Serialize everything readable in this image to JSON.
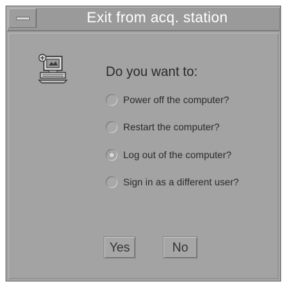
{
  "window": {
    "title": "Exit from acq. station"
  },
  "dialog": {
    "prompt": "Do you want to:",
    "options": [
      {
        "label": "Power off the computer?",
        "selected": false
      },
      {
        "label": "Restart the computer?",
        "selected": false
      },
      {
        "label": "Log out of the computer?",
        "selected": true
      },
      {
        "label": "Sign in as a different user?",
        "selected": false
      }
    ],
    "buttons": {
      "yes": "Yes",
      "no": "No"
    },
    "icon": "computer-icon"
  },
  "colors": {
    "background": "#a3a3a3",
    "title_text": "#ffffff"
  }
}
